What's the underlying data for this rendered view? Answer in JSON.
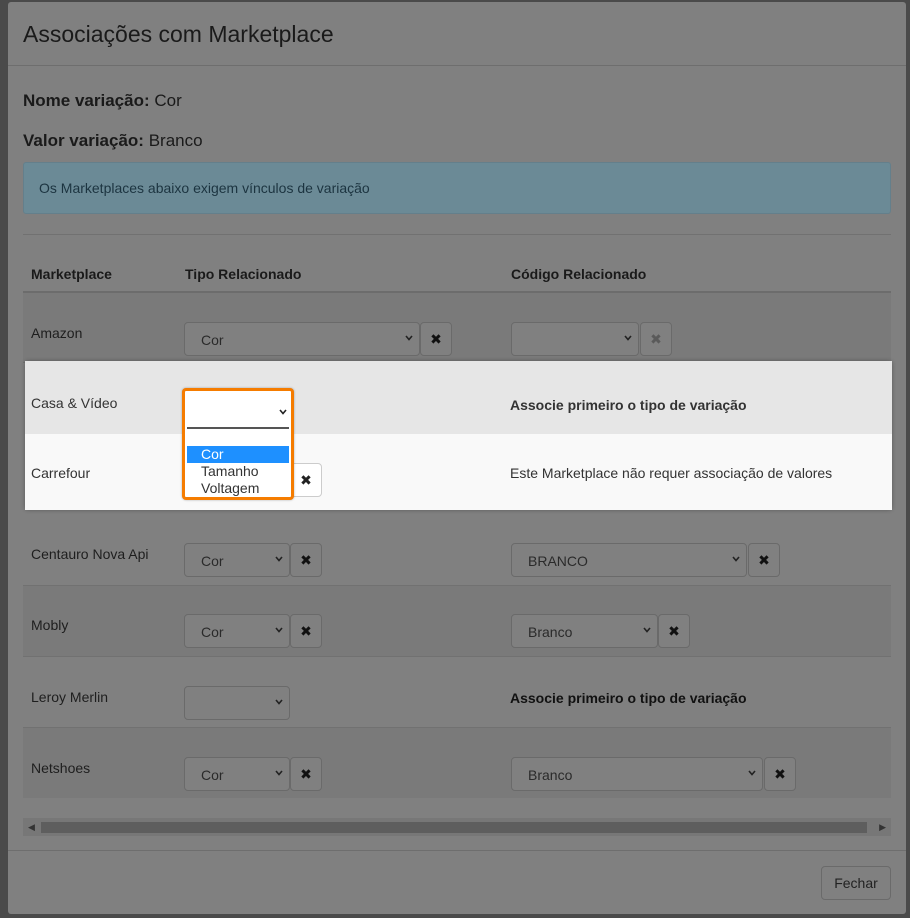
{
  "modal": {
    "title": "Associações com Marketplace",
    "nome_label": "Nome variação:",
    "nome_value": "Cor",
    "valor_label": "Valor variação:",
    "valor_value": "Branco",
    "alert": "Os Marketplaces abaixo exigem vínculos de variação",
    "close_label": "Fechar"
  },
  "table": {
    "headers": [
      "Marketplace",
      "Tipo Relacionado",
      "Código Relacionado"
    ],
    "rows": [
      {
        "marketplace": "Amazon",
        "tipo": "Cor",
        "codigo": ""
      },
      {
        "marketplace": "Casa & Vídeo",
        "tipo": "",
        "note": "Associe primeiro o tipo de variação"
      },
      {
        "marketplace": "Carrefour",
        "note": "Este Marketplace não requer associação de valores"
      },
      {
        "marketplace": "Centauro Nova Api",
        "tipo": "Cor",
        "codigo": "BRANCO"
      },
      {
        "marketplace": "Mobly",
        "tipo": "Cor",
        "codigo": "Branco"
      },
      {
        "marketplace": "Leroy Merlin",
        "tipo": "",
        "note": "Associe primeiro o tipo de variação"
      },
      {
        "marketplace": "Netshoes",
        "tipo": "Cor",
        "codigo": "Branco"
      }
    ]
  },
  "dropdown": {
    "options": [
      "Cor",
      "Tamanho",
      "Voltagem"
    ],
    "highlighted": "Cor"
  },
  "icons": {
    "clear": "✖"
  },
  "colors": {
    "highlight_border": "#f57c00",
    "option_selected": "#1e90ff"
  }
}
